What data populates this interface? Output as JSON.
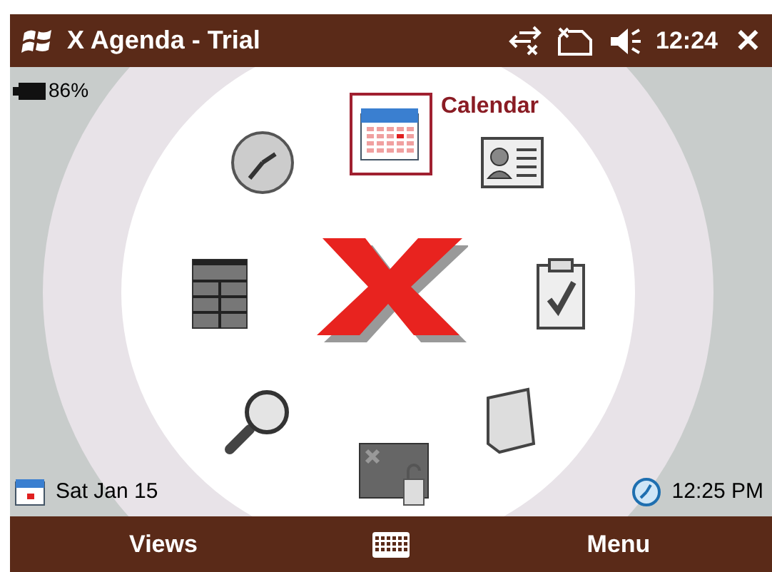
{
  "window": {
    "title": "X Agenda - Trial"
  },
  "status": {
    "time": "12:24",
    "close": "✕"
  },
  "battery": {
    "reading": "86%"
  },
  "launcher": [
    {
      "kind": "calendar",
      "selected": true,
      "label": "Calendar"
    },
    {
      "kind": "contacts",
      "selected": false
    },
    {
      "kind": "tasks",
      "selected": false
    },
    {
      "kind": "notes",
      "selected": false
    },
    {
      "kind": "lock",
      "selected": false
    },
    {
      "kind": "search",
      "selected": false
    },
    {
      "kind": "table",
      "selected": false
    },
    {
      "kind": "clock",
      "selected": false
    }
  ],
  "today": {
    "date": "Sat Jan 15",
    "time": "12:25 PM"
  },
  "softkeys": [
    {
      "label": "Views"
    },
    {
      "label": "Menu"
    }
  ]
}
